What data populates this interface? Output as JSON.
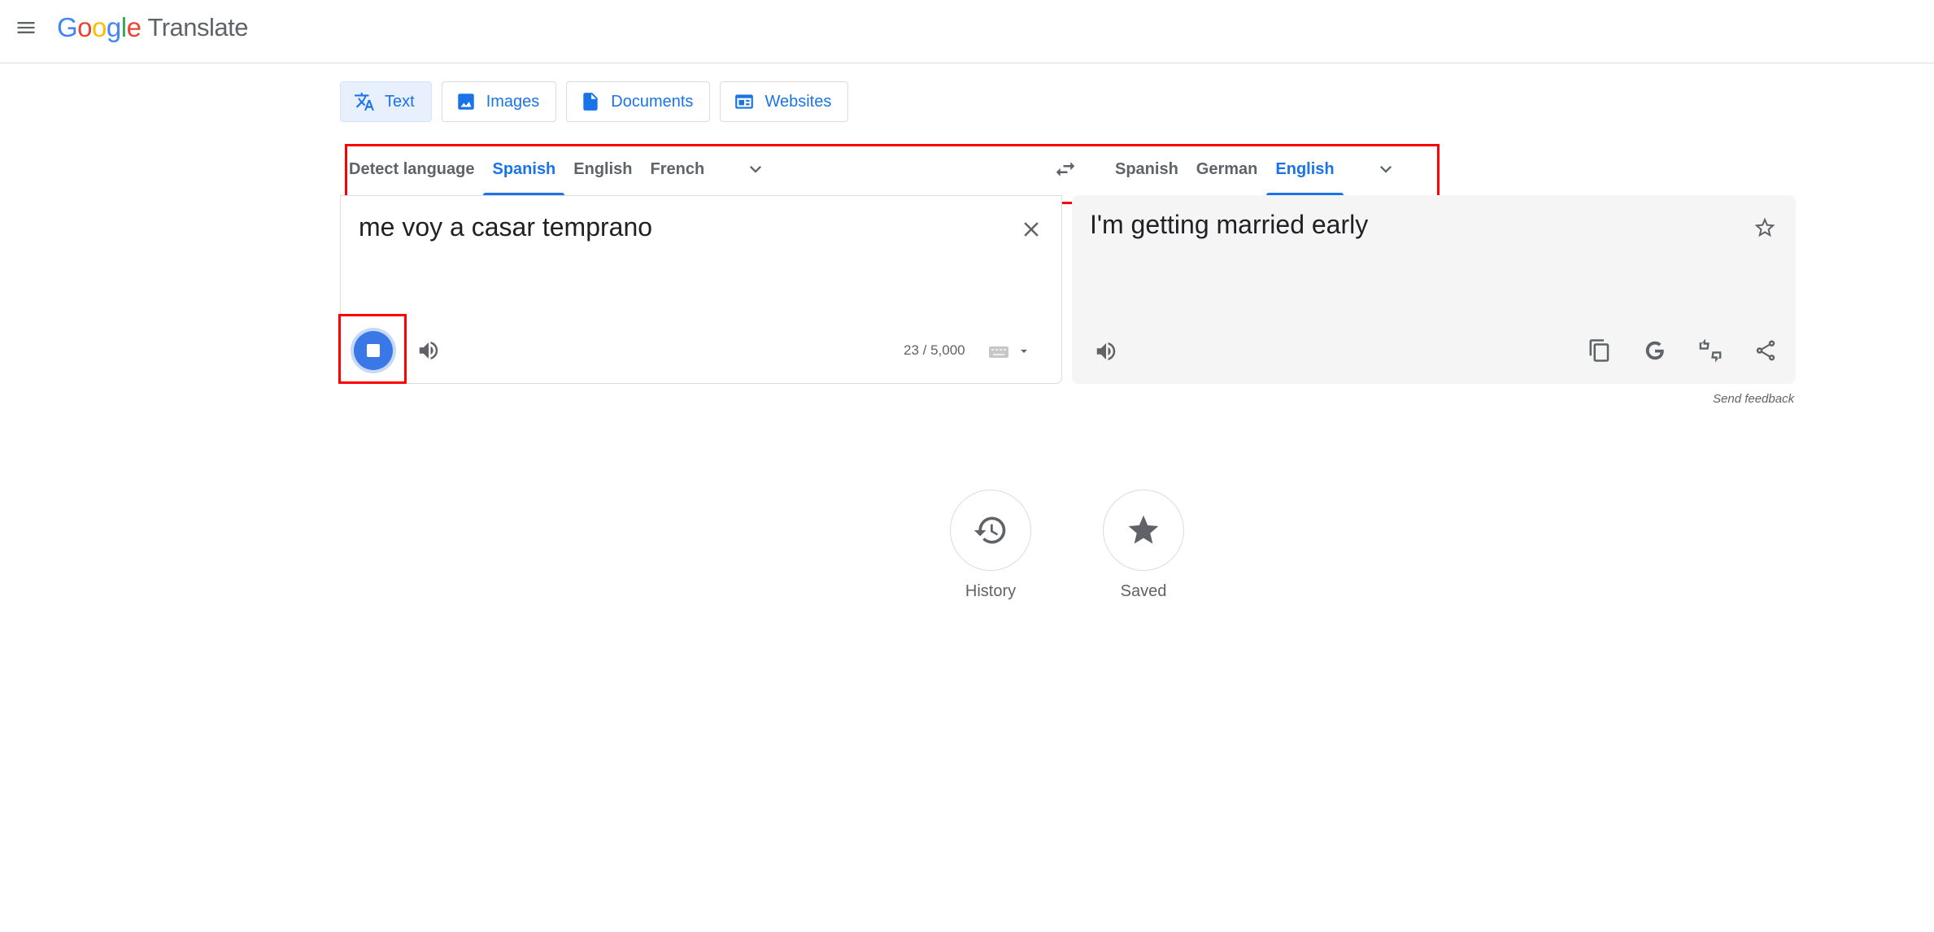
{
  "header": {
    "brand_letters": [
      "G",
      "o",
      "o",
      "g",
      "l",
      "e"
    ],
    "product": "Translate",
    "menu_icon": "hamburger-menu-icon"
  },
  "mode_tabs": [
    {
      "label": "Text",
      "icon": "translate-icon",
      "active": true
    },
    {
      "label": "Images",
      "icon": "image-icon",
      "active": false
    },
    {
      "label": "Documents",
      "icon": "document-icon",
      "active": false
    },
    {
      "label": "Websites",
      "icon": "website-icon",
      "active": false
    }
  ],
  "source_languages": [
    {
      "label": "Detect language",
      "active": false
    },
    {
      "label": "Spanish",
      "active": true
    },
    {
      "label": "English",
      "active": false
    },
    {
      "label": "French",
      "active": false
    }
  ],
  "target_languages": [
    {
      "label": "Spanish",
      "active": false
    },
    {
      "label": "German",
      "active": false
    },
    {
      "label": "English",
      "active": true
    }
  ],
  "source": {
    "text": "me voy a casar temprano",
    "char_count": "23 / 5,000"
  },
  "target": {
    "text": "I'm getting married early"
  },
  "send_feedback": "Send feedback",
  "bottom": {
    "history_label": "History",
    "saved_label": "Saved"
  },
  "colors": {
    "accent": "#1a73e8",
    "highlight": "#ff0000",
    "stop_button": "#3b78e7"
  }
}
